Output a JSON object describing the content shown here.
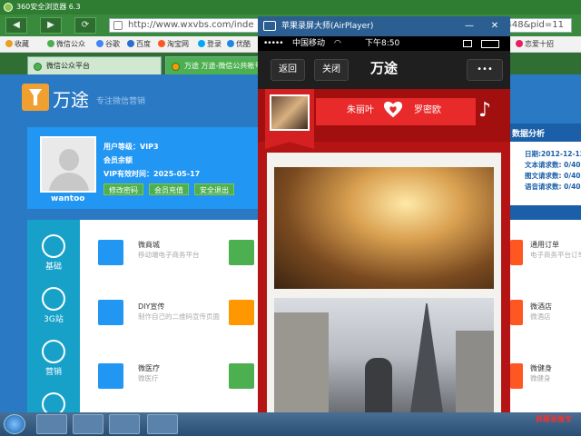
{
  "browser": {
    "title": "360安全浏览器 6.3",
    "url_visible": "http://www.wxvbs.com/inde",
    "url_tail": "448&pid=11",
    "favorites": [
      "收藏",
      "微信公众",
      "谷歌",
      "百度",
      "淘宝网",
      "登录",
      "优酷",
      "谷歌",
      "京东",
      "恋爱十招"
    ],
    "tabs": [
      {
        "label": "微信公众平台",
        "active": false
      },
      {
        "label": "万途 万途-微信公共帐号",
        "active": true
      }
    ]
  },
  "site": {
    "brand": "万途",
    "slogan": "专注微信营销",
    "profile": {
      "username": "wantoo",
      "level": "用户等级：VIP3",
      "balance": "会员余额",
      "vip_until": "VIP有效时间：2025-05-17",
      "buttons": [
        "修改密码",
        "会员充值",
        "安全退出"
      ]
    },
    "sidenav": [
      "基础",
      "3G站",
      "营销"
    ],
    "tiles": [
      {
        "title": "微商城",
        "desc": "移动端电子商务平台"
      },
      {
        "title": "DIY宣传",
        "desc": "制作自己的二维码宣传页面"
      },
      {
        "title": "微医疗",
        "desc": "微医疗"
      }
    ],
    "right_panel": {
      "title": "数据分析",
      "date": "日期:2012-12-12",
      "lines": [
        "文本请求数: 0/40",
        "图文请求数: 0/40",
        "语音请求数: 0/40"
      ],
      "tiles": [
        {
          "title": "通用订单",
          "desc": "电子商务平台订单处理"
        },
        {
          "title": "微酒店",
          "desc": "微酒店"
        },
        {
          "title": "微健身",
          "desc": "微健身"
        }
      ]
    }
  },
  "airplayer": {
    "title": "苹果录屏大师(AirPlayer)",
    "status": {
      "carrier": "中国移动",
      "time": "下午8:50"
    },
    "nav": {
      "back": "返回",
      "close": "关闭",
      "title": "万途",
      "more": "•••"
    },
    "banner": {
      "left_name": "朱丽叶",
      "right_name": "罗密欧"
    }
  },
  "taskbar": {
    "tray_text": "屏幕录像专"
  },
  "colors": {
    "accent": "#2196f3",
    "brand_orange": "#f0a030",
    "wechat_red": "#b51414"
  }
}
